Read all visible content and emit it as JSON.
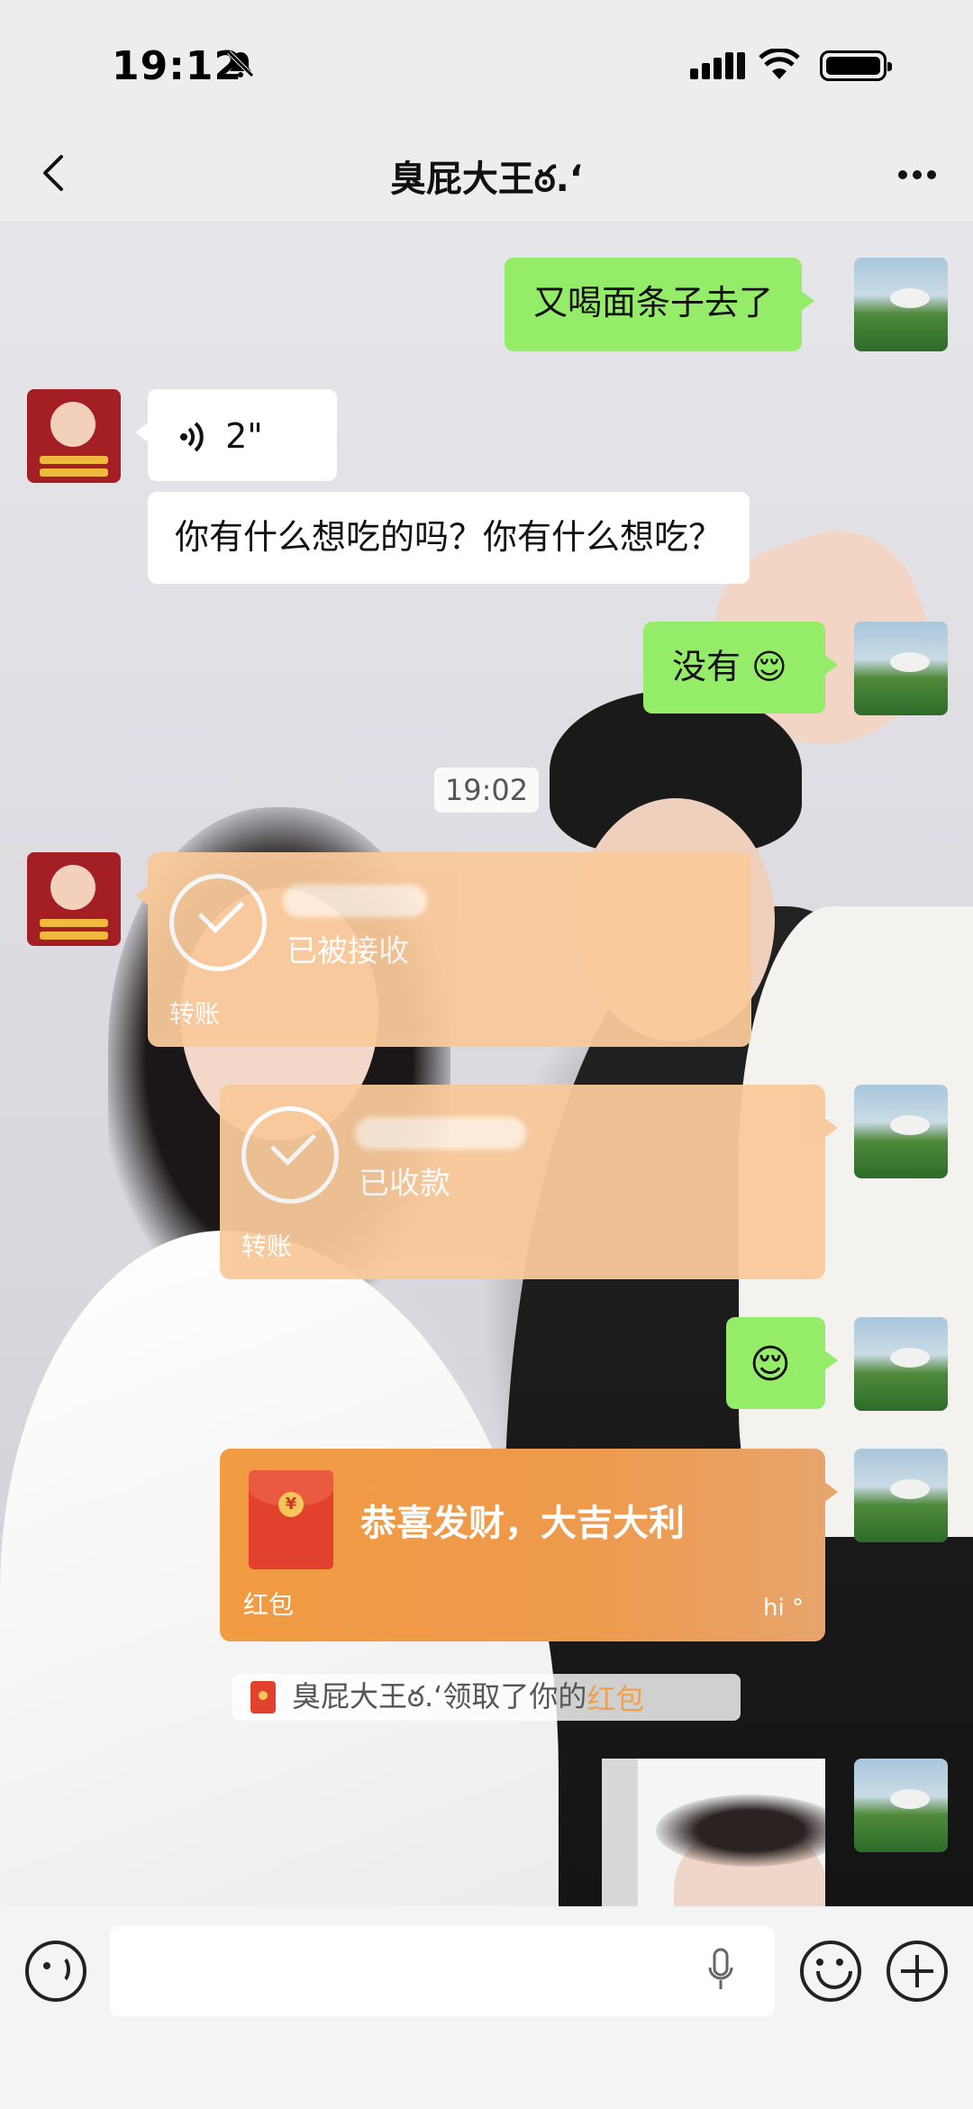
{
  "status_bar": {
    "time": "19:12",
    "icons": [
      "bell-off-icon",
      "cellular-signal-icon",
      "wifi-icon",
      "battery-icon"
    ]
  },
  "nav": {
    "title": "臭屁大王ఠ.ʻ",
    "back_icon": "chevron-left-icon",
    "more_icon": "more-horizontal-icon"
  },
  "messages": [
    {
      "id": "m1",
      "sender": "me",
      "type": "text",
      "text": "又喝面条子去了"
    },
    {
      "id": "m2",
      "sender": "them",
      "type": "voice",
      "duration": "2\""
    },
    {
      "id": "m3",
      "sender": "them",
      "type": "text",
      "text": "你有什么想吃的吗？你有什么想吃？"
    },
    {
      "id": "m4",
      "sender": "me",
      "type": "text",
      "text": "没有",
      "emoji": "😌"
    },
    {
      "id": "ts1",
      "type": "timestamp",
      "text": "19:02"
    },
    {
      "id": "m5",
      "sender": "them",
      "type": "transfer",
      "status": "已被接收",
      "label": "转账"
    },
    {
      "id": "m6",
      "sender": "me",
      "type": "transfer",
      "status": "已收款",
      "label": "转账"
    },
    {
      "id": "m7",
      "sender": "me",
      "type": "emoji",
      "emoji": "😌"
    },
    {
      "id": "m8",
      "sender": "me",
      "type": "red_packet",
      "title": "恭喜发财，大吉大利",
      "label": "红包",
      "watermark": "hi °"
    },
    {
      "id": "sys1",
      "type": "system",
      "prefix": "臭屁大王ఠ.ʻ领取了你的",
      "highlight": "红包"
    },
    {
      "id": "m9",
      "sender": "me",
      "type": "image"
    }
  ],
  "input_bar": {
    "voice_icon": "voice-input-icon",
    "mic_icon": "microphone-icon",
    "emoji_icon": "emoji-icon",
    "plus_icon": "plus-circle-icon",
    "placeholder": ""
  },
  "colors": {
    "bubble_me": "#95ec69",
    "bubble_them": "#ffffff",
    "transfer": "#f8c99a",
    "red_packet": "#f19b42",
    "highlight": "#f0a04b"
  }
}
